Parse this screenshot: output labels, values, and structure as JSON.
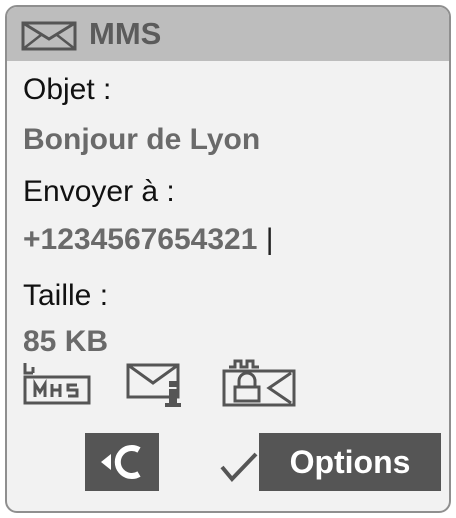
{
  "header": {
    "title": "MMS",
    "icon": "envelope-icon"
  },
  "subject": {
    "label": "Objet :",
    "value": "Bonjour de Lyon"
  },
  "recipient": {
    "label": "Envoyer à :",
    "value": "+1234567654321",
    "cursor": "|"
  },
  "size": {
    "label": "Taille :",
    "value": "85 KB"
  },
  "attachment_icons": [
    "mms-picture-icon",
    "message-info-icon",
    "locked-message-icon"
  ],
  "softkeys": {
    "left_icon": "clear-back-icon",
    "confirm_icon": "checkmark-icon",
    "right_label": "Options"
  },
  "colors": {
    "title_bar": "#bdbdbd",
    "softkey": "#555555",
    "value_text": "#6a6a6a"
  }
}
